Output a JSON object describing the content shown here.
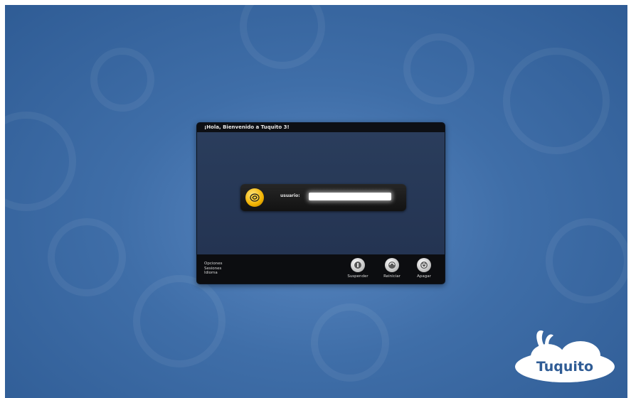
{
  "window": {
    "title": "¡Hola, Bienvenido a Tuquito 3!"
  },
  "login": {
    "user_label": "usuario:",
    "user_value": "",
    "avatar_icon": "tuquito-user-icon"
  },
  "footer_menu": {
    "items": [
      "Opciones",
      "Sesiones",
      "Idioma"
    ]
  },
  "power_buttons": [
    {
      "label": "Suspender",
      "icon": "suspend-icon"
    },
    {
      "label": "Reiniciar",
      "icon": "restart-icon"
    },
    {
      "label": "Apagar",
      "icon": "power-icon"
    }
  ],
  "brand": {
    "logo_text": "Tuquito"
  },
  "colors": {
    "wallpaper": "#3f6ea8",
    "avatar": "#f2b200",
    "window": "#1f2f48"
  }
}
